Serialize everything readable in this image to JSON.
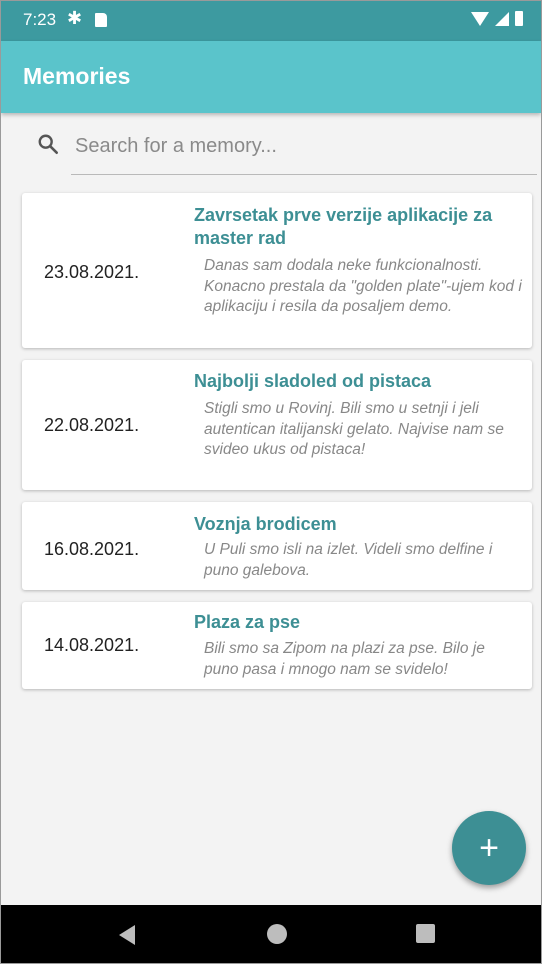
{
  "status_bar": {
    "time": "7:23",
    "icons": [
      "gear-icon",
      "sd-card-icon",
      "wifi-icon",
      "signal-icon",
      "battery-icon"
    ]
  },
  "app_bar": {
    "title": "Memories"
  },
  "search": {
    "placeholder": "Search for a memory...",
    "value": "",
    "icon": "search-icon"
  },
  "memories": [
    {
      "date": "23.08.2021.",
      "title": "Zavrsetak prve verzije aplikacije za master rad",
      "description": "Danas sam dodala neke funkcionalnosti. Konacno prestala da \"golden plate\"-ujem kod i aplikaciju i resila da posaljem demo."
    },
    {
      "date": "22.08.2021.",
      "title": "Najbolji sladoled od pistaca",
      "description": "Stigli smo u Rovinj. Bili smo u setnji i jeli autentican italijanski gelato. Najvise nam se svideo ukus od pistaca!"
    },
    {
      "date": "16.08.2021.",
      "title": "Voznja brodicem",
      "description": "U Puli smo isli na izlet. Videli smo delfine i puno galebova."
    },
    {
      "date": "14.08.2021.",
      "title": "Plaza za pse",
      "description": "Bili smo sa Zipom na plazi za pse. Bilo je puno pasa i mnogo nam se svidelo!"
    }
  ],
  "fab": {
    "label": "+",
    "icon": "add-icon"
  },
  "colors": {
    "status_bar": "#3d9aa0",
    "app_bar": "#5ac4cb",
    "accent": "#3d8f94",
    "background": "#f3f3f3"
  }
}
